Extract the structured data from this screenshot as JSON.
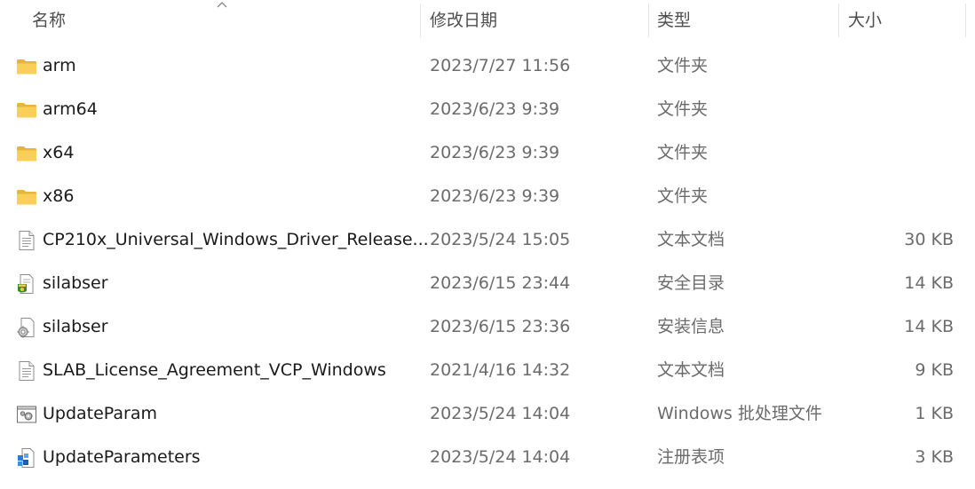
{
  "header": {
    "name": "名称",
    "date": "修改日期",
    "type": "类型",
    "size": "大小",
    "sort": "ascending"
  },
  "files": [
    {
      "name": "arm",
      "date": "2023/7/27 11:56",
      "type": "文件夹",
      "size": "",
      "icon": "folder-icon"
    },
    {
      "name": "arm64",
      "date": "2023/6/23 9:39",
      "type": "文件夹",
      "size": "",
      "icon": "folder-icon"
    },
    {
      "name": "x64",
      "date": "2023/6/23 9:39",
      "type": "文件夹",
      "size": "",
      "icon": "folder-icon"
    },
    {
      "name": "x86",
      "date": "2023/6/23 9:39",
      "type": "文件夹",
      "size": "",
      "icon": "folder-icon"
    },
    {
      "name": "CP210x_Universal_Windows_Driver_Release...",
      "date": "2023/5/24 15:05",
      "type": "文本文档",
      "size": "30 KB",
      "icon": "text-document-icon"
    },
    {
      "name": "silabser",
      "date": "2023/6/15 23:44",
      "type": "安全目录",
      "size": "14 KB",
      "icon": "security-catalog-icon"
    },
    {
      "name": "silabser",
      "date": "2023/6/15 23:36",
      "type": "安装信息",
      "size": "14 KB",
      "icon": "setup-information-icon"
    },
    {
      "name": "SLAB_License_Agreement_VCP_Windows",
      "date": "2021/4/16 14:32",
      "type": "文本文档",
      "size": "9 KB",
      "icon": "text-document-icon"
    },
    {
      "name": "UpdateParam",
      "date": "2023/5/24 14:04",
      "type": "Windows 批处理文件",
      "size": "1 KB",
      "icon": "batch-file-icon"
    },
    {
      "name": "UpdateParameters",
      "date": "2023/5/24 14:04",
      "type": "注册表项",
      "size": "3 KB",
      "icon": "registry-file-icon"
    }
  ]
}
